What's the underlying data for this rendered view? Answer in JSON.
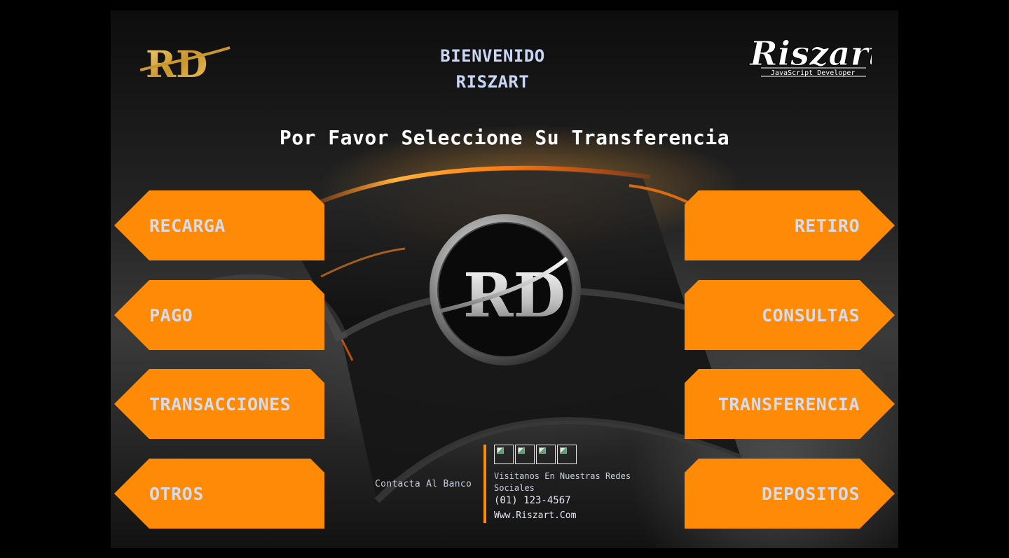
{
  "header": {
    "welcome_line1": "BIENVENIDO",
    "welcome_line2": "RISZART",
    "logo_left_text": "RD",
    "logo_right_text": "Riszart",
    "logo_right_subtitle": "JavaScript Developer"
  },
  "instruction": "Por Favor Seleccione Su Transferencia",
  "menu_left": [
    {
      "label": "RECARGA"
    },
    {
      "label": "PAGO"
    },
    {
      "label": "TRANSACCIONES"
    },
    {
      "label": "OTROS"
    }
  ],
  "menu_right": [
    {
      "label": "RETIRO"
    },
    {
      "label": "CONSULTAS"
    },
    {
      "label": "TRANSFERENCIA"
    },
    {
      "label": "DEPOSITOS"
    }
  ],
  "emblem_text": "RD",
  "footer": {
    "contact_label": "Contacta Al Banco",
    "social_icons": [
      "broken-image-icon",
      "broken-image-icon",
      "broken-image-icon",
      "broken-image-icon"
    ],
    "visit_text": "Visitanos En Nuestras Redes Sociales",
    "phone": "(01) 123-4567",
    "website": "Www.Riszart.Com"
  },
  "colors": {
    "accent": "#ff8a05",
    "button_text": "#d6dcef",
    "background": "#000000",
    "welcome_text": "#c9d6f5"
  }
}
